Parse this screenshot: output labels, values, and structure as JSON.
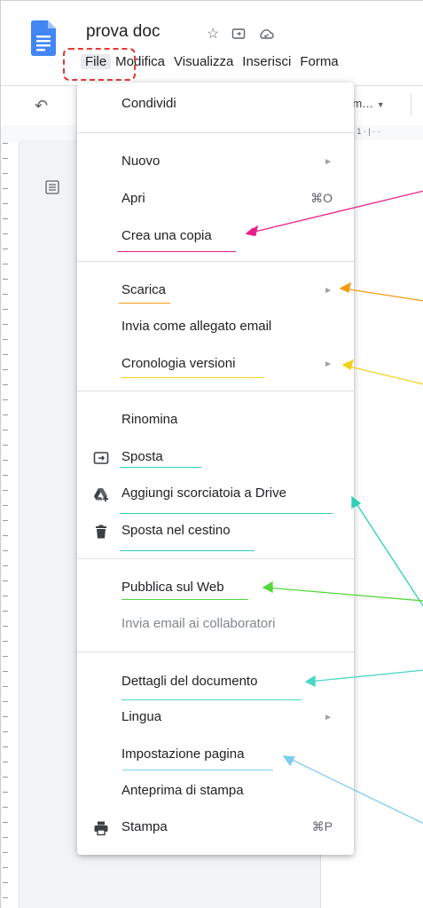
{
  "document": {
    "title": "prova doc"
  },
  "menubar": [
    "File",
    "Modifica",
    "Visualizza",
    "Inserisci",
    "Forma"
  ],
  "toolbar": {
    "format_label": "rm…"
  },
  "ruler": {
    "marker": "1"
  },
  "file_menu": {
    "condividi": "Condividi",
    "nuovo": "Nuovo",
    "apri": "Apri",
    "apri_shortcut": "⌘O",
    "crea_copia": "Crea una copia",
    "scarica": "Scarica",
    "invia_allegato": "Invia come allegato email",
    "cronologia": "Cronologia versioni",
    "rinomina": "Rinomina",
    "sposta": "Sposta",
    "scorciatoia": "Aggiungi scorciatoia a Drive",
    "cestino": "Sposta nel cestino",
    "pubblica": "Pubblica sul Web",
    "invia_collaboratori": "Invia email ai collaboratori",
    "dettagli": "Dettagli del documento",
    "lingua": "Lingua",
    "impostazione": "Impostazione pagina",
    "anteprima": "Anteprima di stampa",
    "stampa": "Stampa",
    "stampa_shortcut": "⌘P",
    "submenu_arrow": "►"
  },
  "colors": {
    "highlight_file": "#e53935",
    "crea_copia": "#e91e8c",
    "scarica": "#f39c12",
    "cronologia": "#f1d21b",
    "drive_actions": "#2ecfb8",
    "pubblica": "#52d63a",
    "dettagli": "#46d7c5",
    "impostazione": "#7fcdf0"
  }
}
